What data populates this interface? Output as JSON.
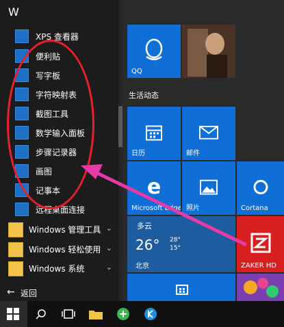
{
  "app_list": {
    "group_letter": "W",
    "items": [
      {
        "label": "XPS 查看器",
        "icon": "xps-viewer-icon"
      },
      {
        "label": "便利贴",
        "icon": "sticky-notes-icon"
      },
      {
        "label": "写字板",
        "icon": "wordpad-icon"
      },
      {
        "label": "字符映射表",
        "icon": "character-map-icon"
      },
      {
        "label": "截图工具",
        "icon": "snipping-tool-icon"
      },
      {
        "label": "数学输入面板",
        "icon": "math-input-icon"
      },
      {
        "label": "步骤记录器",
        "icon": "steps-recorder-icon"
      },
      {
        "label": "画图",
        "icon": "paint-icon"
      },
      {
        "label": "记事本",
        "icon": "notepad-icon"
      },
      {
        "label": "远程桌面连接",
        "icon": "remote-desktop-icon"
      }
    ],
    "folders": [
      {
        "label": "Windows 管理工具",
        "chevron": "⌄"
      },
      {
        "label": "Windows 轻松使用",
        "chevron": "⌄"
      },
      {
        "label": "Windows 系统",
        "chevron": "⌄"
      }
    ],
    "back_label": "返回",
    "back_arrow": "←"
  },
  "tiles": {
    "section_title": "生活动态",
    "qq": {
      "label": "QQ",
      "color": "#0f6fd6"
    },
    "calendar": {
      "label": "日历"
    },
    "mail": {
      "label": "邮件"
    },
    "edge": {
      "label": "Microsoft Edge"
    },
    "photos": {
      "label": "照片"
    },
    "cortana": {
      "label": "Cortana"
    },
    "weather": {
      "condition": "多云",
      "temp": "26°",
      "high": "28°",
      "low": "15°",
      "city": "北京"
    },
    "zaker": {
      "label": "ZAKER HD",
      "color": "#d81e1e"
    },
    "store": {
      "label": ""
    }
  },
  "taskbar": {
    "items": [
      "start-icon",
      "search-icon",
      "task-view-icon",
      "file-explorer-icon",
      "browser-icon",
      "k-app-icon"
    ]
  },
  "colors": {
    "accent": "#0f6fd6",
    "annotation": "#e8202d",
    "arrow": "#e63aa8"
  }
}
